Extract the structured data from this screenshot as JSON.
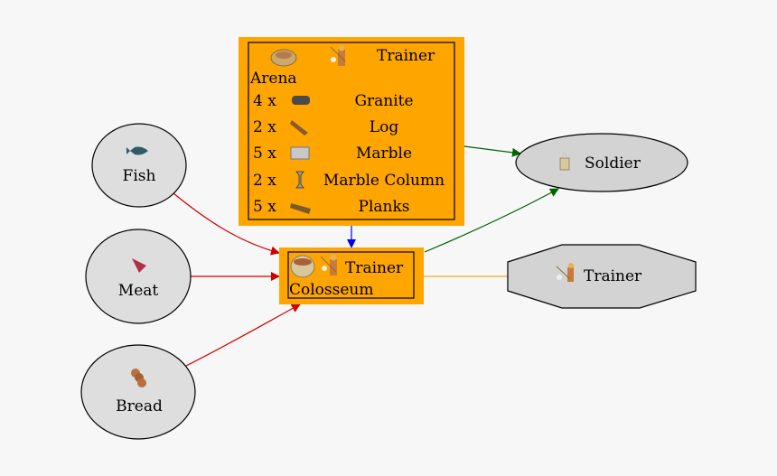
{
  "nodes": {
    "arena": {
      "title": "Arena",
      "produces": "Trainer",
      "fill": "#ffa500",
      "costs": [
        {
          "qty": "4 x",
          "item": "Granite",
          "icon": "granite-icon"
        },
        {
          "qty": "2 x",
          "item": "Log",
          "icon": "log-icon"
        },
        {
          "qty": "5 x",
          "item": "Marble",
          "icon": "marble-icon"
        },
        {
          "qty": "2 x",
          "item": "Marble Column",
          "icon": "marble-column-icon"
        },
        {
          "qty": "5 x",
          "item": "Planks",
          "icon": "planks-icon"
        }
      ]
    },
    "colosseum": {
      "title": "Colosseum",
      "produces": "Trainer",
      "fill": "#ffa500"
    },
    "fish": {
      "label": "Fish",
      "icon": "fish-icon"
    },
    "meat": {
      "label": "Meat",
      "icon": "meat-icon"
    },
    "bread": {
      "label": "Bread",
      "icon": "bread-icon"
    },
    "soldier": {
      "label": "Soldier",
      "icon": "soldier-icon"
    },
    "trainer": {
      "label": "Trainer",
      "icon": "trainer-icon"
    }
  },
  "edges": [
    {
      "from": "Fish",
      "to": "Colosseum",
      "color": "#cc0000"
    },
    {
      "from": "Meat",
      "to": "Colosseum",
      "color": "#cc0000"
    },
    {
      "from": "Bread",
      "to": "Colosseum",
      "color": "#cc0000"
    },
    {
      "from": "Arena",
      "to": "Colosseum",
      "color": "#0000ff"
    },
    {
      "from": "Arena",
      "to": "Soldier",
      "color": "#006400"
    },
    {
      "from": "Colosseum",
      "to": "Soldier",
      "color": "#006400"
    },
    {
      "from": "Colosseum",
      "to": "Trainer",
      "color": "#f4b942"
    }
  ]
}
